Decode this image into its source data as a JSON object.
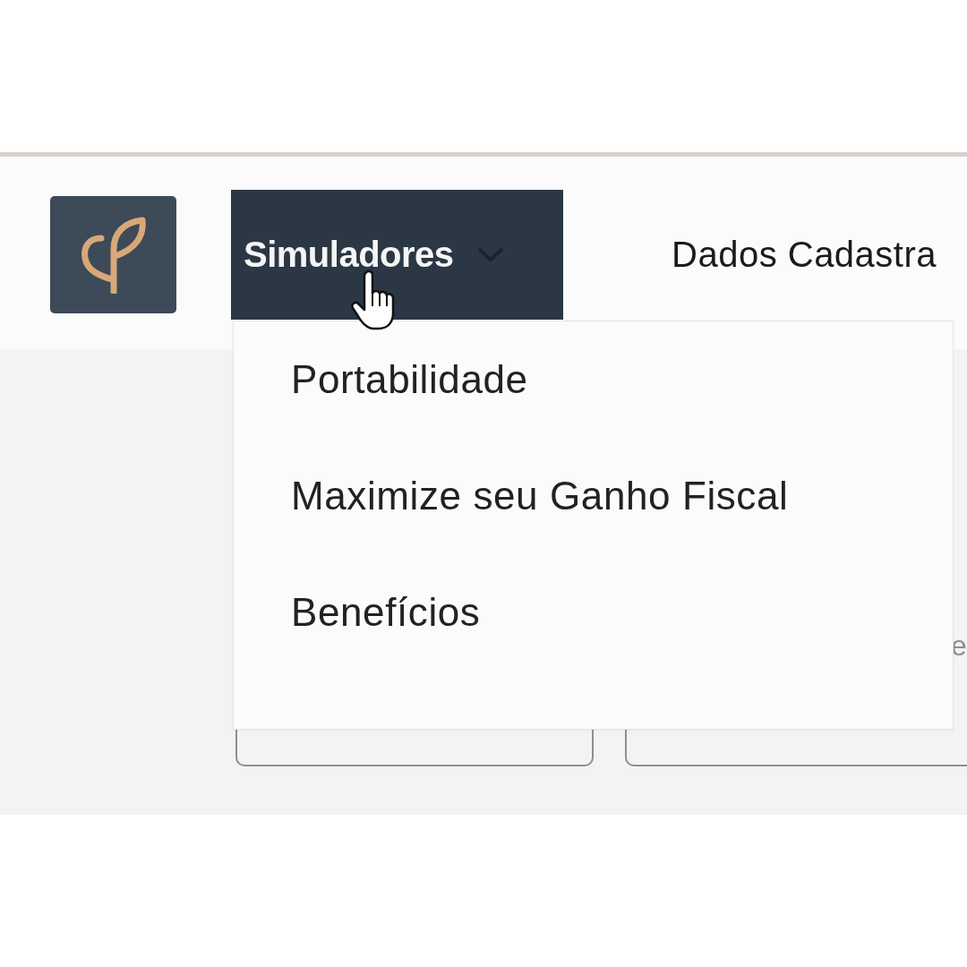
{
  "header": {
    "nav": [
      {
        "label": "Simuladores",
        "expanded": true
      },
      {
        "label": "Dados Cadastra",
        "expanded": false
      }
    ]
  },
  "dropdown": {
    "items": [
      "Portabilidade",
      "Maximize seu Ganho Fiscal",
      "Benefícios"
    ]
  },
  "card_text": "e"
}
